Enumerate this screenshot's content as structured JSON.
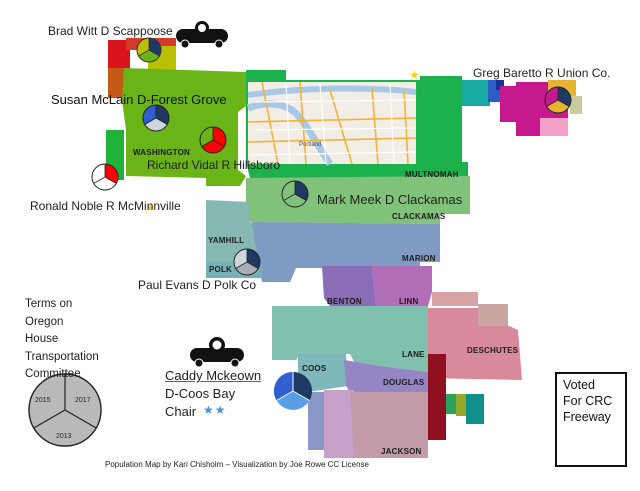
{
  "legislators": {
    "witt": "Brad Witt D Scappoose",
    "mclain": "Susan McLain D-Forest Grove",
    "vidal": "Richard Vidal R Hillsboro",
    "noble": "Ronald Noble R McMinnville",
    "meek": "Mark Meek  D Clackamas",
    "barreto": "Greg Baretto R Union Co.",
    "evans": "Paul Evans D Polk Co",
    "mckeown_name": "Caddy Mckeown",
    "mckeown_city": "D-Coos Bay",
    "mckeown_role": "Chair",
    "mckeown_stars": "★★"
  },
  "counties": {
    "washington": "WASHINGTON",
    "multnomah": "MULTNOMAH",
    "clackamas": "CLACKAMAS",
    "yamhill": "YAMHILL",
    "polk": "POLK",
    "marion": "MARION",
    "benton": "BENTON",
    "linn": "LINN",
    "lane": "LANE",
    "deschutes": "DESCHUTES",
    "coos": "COOS",
    "douglas": "DOUGLAS",
    "jackson": "JACKSON"
  },
  "inset": {
    "city": "Portland"
  },
  "terms_legend": {
    "heading_lines": [
      "Terms on",
      "Oregon",
      "House",
      "Transportation",
      "Committee"
    ],
    "slices": [
      "2015",
      "2017",
      "2013"
    ]
  },
  "crc_legend": {
    "lines": [
      "Voted",
      "For CRC",
      "Freeway"
    ]
  },
  "credit": "Population  Map by Kari Chisholm  – Visualization  by Joe Rowe  CC License",
  "colors": {
    "term_2015": "#1f3864",
    "term_2017": "#2f5fd0",
    "term_2013": "#cfd5dc",
    "term_2015_republican_slice": "#ff0000",
    "washington_green": "#6ab417",
    "multnomah_green": "#1bb14c"
  }
}
